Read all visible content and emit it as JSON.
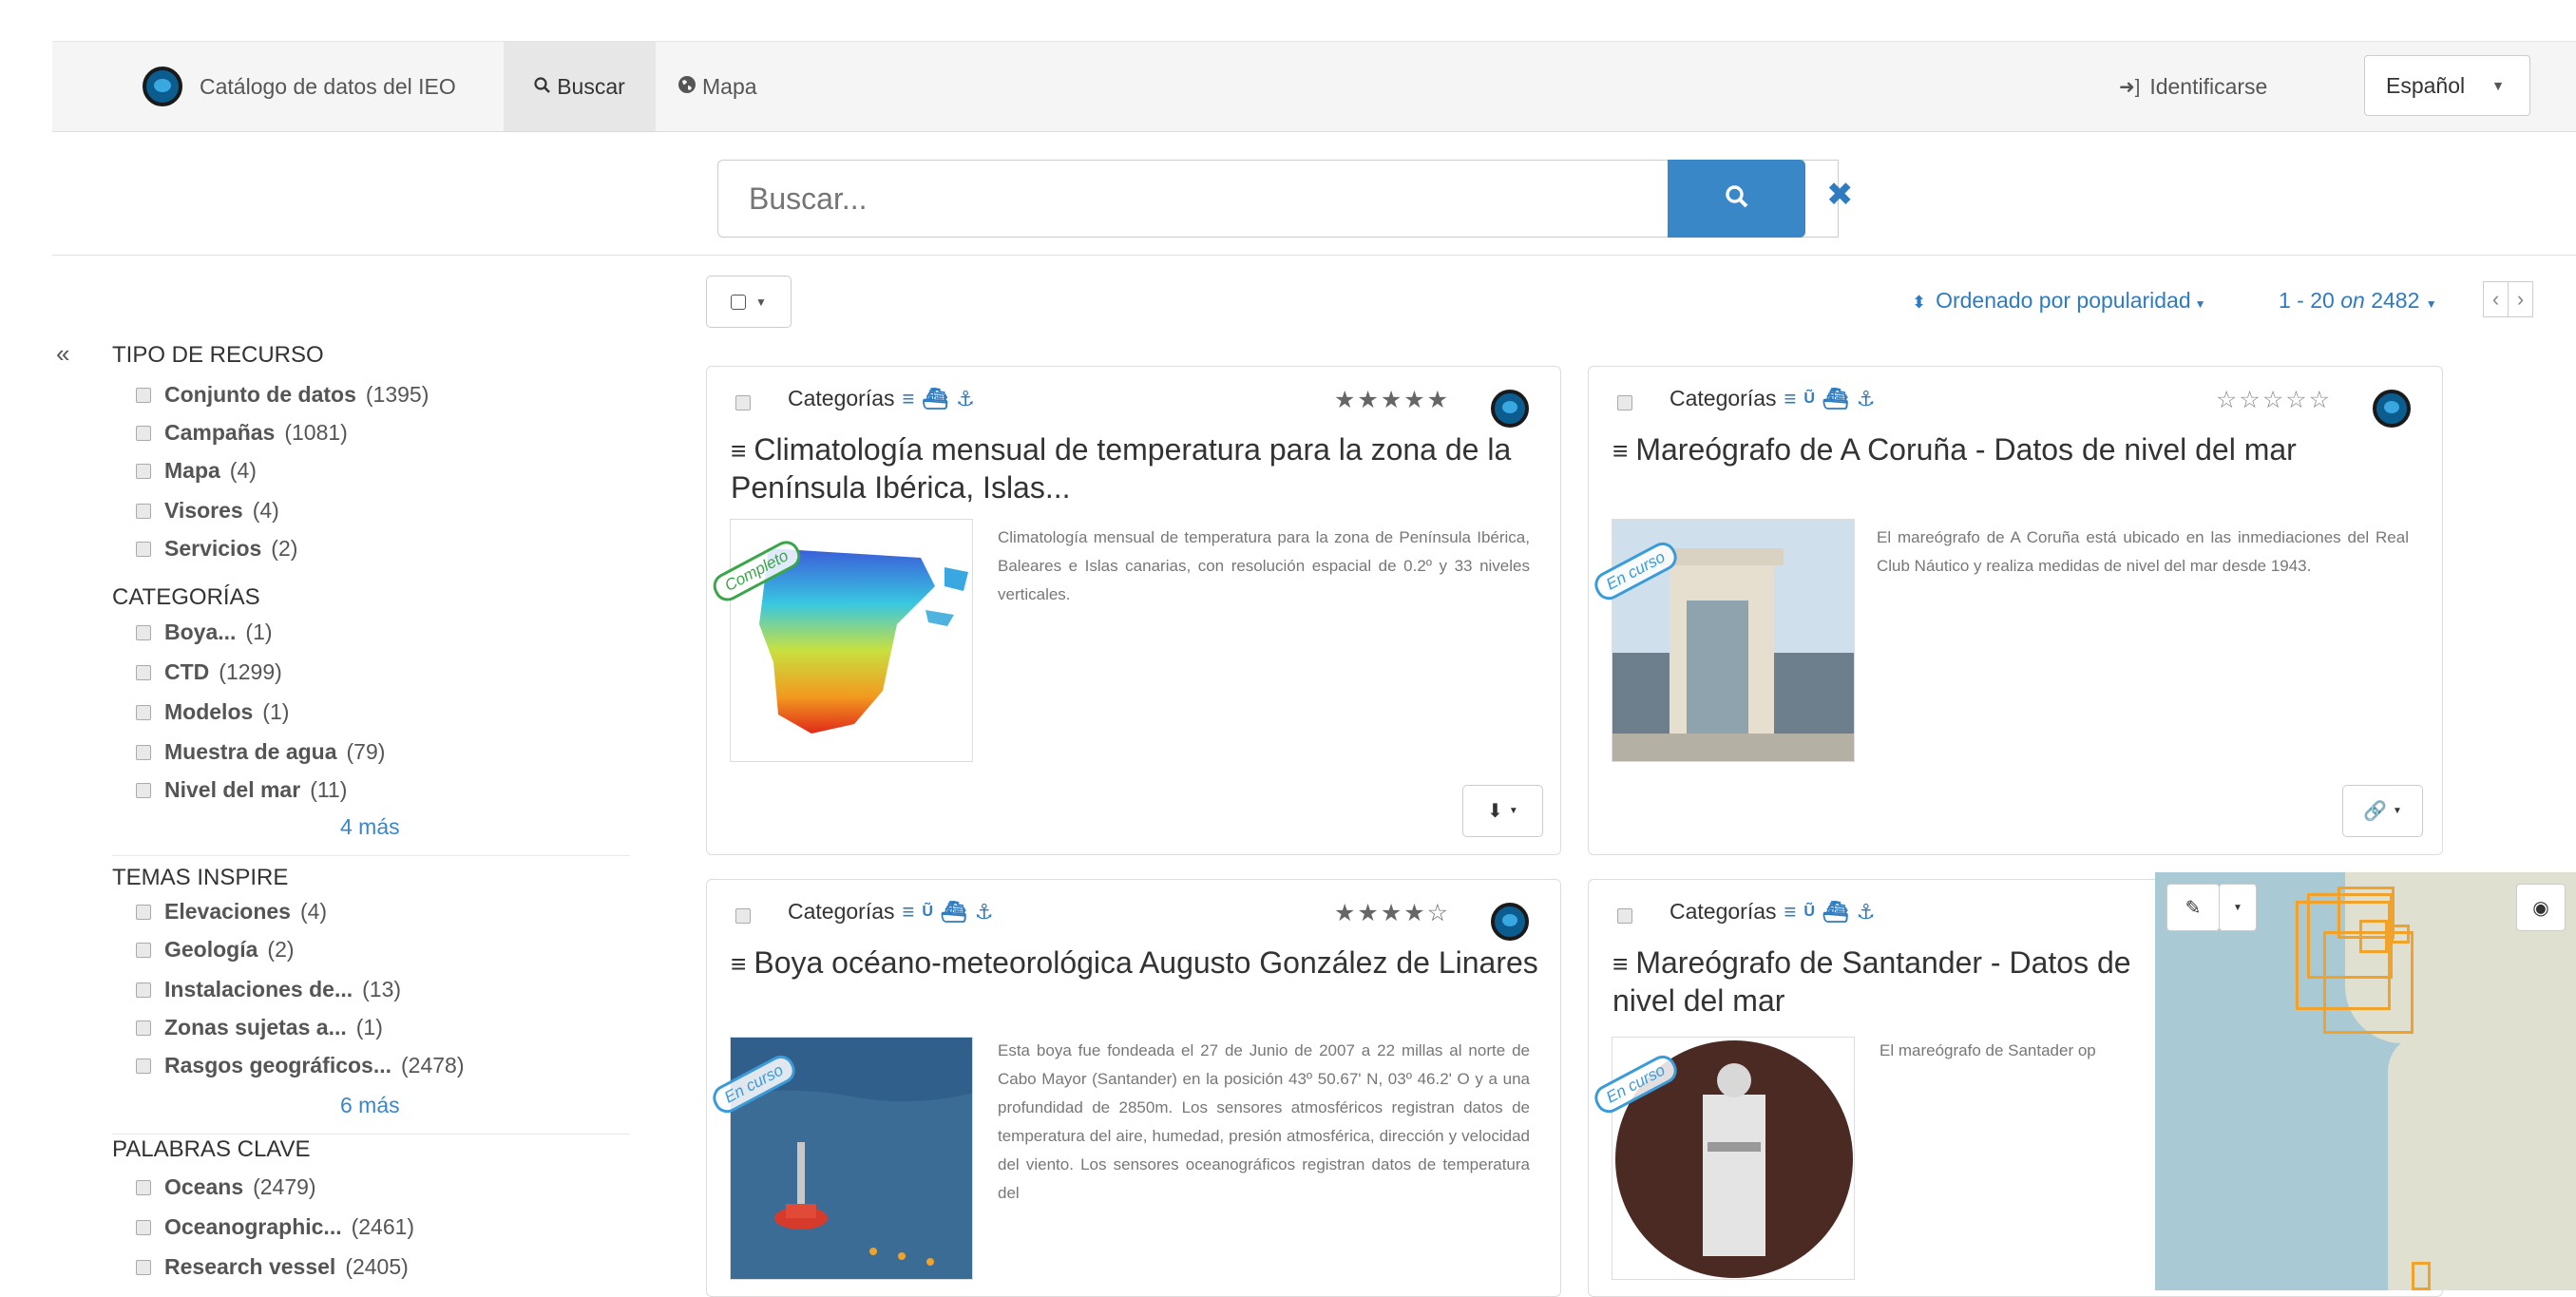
{
  "nav": {
    "brand": "Catálogo de datos del IEO",
    "search_tab": "Buscar",
    "map_tab": "Mapa",
    "login": "Identificarse",
    "language": "Español"
  },
  "search": {
    "placeholder": "Buscar..."
  },
  "toolbar": {
    "sort_label": "Ordenado por popularidad",
    "paging_range": "1 - 20",
    "paging_on": "on",
    "paging_total": "2482"
  },
  "facets": {
    "resource_type": {
      "title": "TIPO DE RECURSO",
      "items": [
        {
          "label": "Conjunto de datos",
          "count": "(1395)"
        },
        {
          "label": "Campañas",
          "count": "(1081)"
        },
        {
          "label": "Mapa",
          "count": "(4)"
        },
        {
          "label": "Visores",
          "count": "(4)"
        },
        {
          "label": "Servicios",
          "count": "(2)"
        }
      ]
    },
    "categories": {
      "title": "CATEGORÍAS",
      "items": [
        {
          "label": "Boya...",
          "count": "(1)"
        },
        {
          "label": "CTD",
          "count": "(1299)"
        },
        {
          "label": "Modelos",
          "count": "(1)"
        },
        {
          "label": "Muestra de agua",
          "count": "(79)"
        },
        {
          "label": "Nivel del mar",
          "count": "(11)"
        }
      ],
      "more": "4 más"
    },
    "inspire": {
      "title": "TEMAS INSPIRE",
      "items": [
        {
          "label": "Elevaciones",
          "count": "(4)"
        },
        {
          "label": "Geología",
          "count": "(2)"
        },
        {
          "label": "Instalaciones de...",
          "count": "(13)"
        },
        {
          "label": "Zonas sujetas a...",
          "count": "(1)"
        },
        {
          "label": "Rasgos geográficos...",
          "count": "(2478)"
        }
      ],
      "more": "6 más"
    },
    "keywords": {
      "title": "PALABRAS CLAVE",
      "items": [
        {
          "label": "Oceans",
          "count": "(2479)"
        },
        {
          "label": "Oceanographic...",
          "count": "(2461)"
        },
        {
          "label": "Research vessel",
          "count": "(2405)"
        }
      ]
    }
  },
  "cards": [
    {
      "categories": "Categorías",
      "stars": "★★★★★",
      "rating": 5,
      "title": "Climatología mensual de temperatura para la zona de la Península Ibérica, Islas...",
      "abstract": "Climatología mensual de temperatura para la zona de Península Ibérica, Baleares e Islas canarias, con resolución espacial de 0.2º y 33 niveles verticales.",
      "badge": "Completo",
      "action_icon": "download-icon"
    },
    {
      "categories": "Categorías",
      "stars": "☆☆☆☆☆",
      "rating": 0,
      "title": "Mareógrafo de A Coruña - Datos de nivel del mar",
      "abstract": "El mareógrafo de A Coruña está ubicado en las inmediaciones del Real Club Náutico y realiza medidas de nivel del mar desde 1943.",
      "badge": "En curso",
      "action_icon": "link-icon"
    },
    {
      "categories": "Categorías",
      "stars": "★★★★☆",
      "rating": 4,
      "title": "Boya océano-meteorológica Augusto González de Linares",
      "abstract": "Esta boya fue fondeada el 27 de Junio de 2007 a 22 millas al norte de Cabo Mayor (Santander) en la posición 43º 50.67' N, 03º 46.2' O y a una profundidad de 2850m. Los sensores atmosféricos registran datos de temperatura del aire, humedad, presión atmosférica, dirección y velocidad del viento. Los sensores oceanográficos registran datos de temperatura del",
      "badge": "En curso"
    },
    {
      "categories": "Categorías",
      "title": "Mareógrafo de Santander - Datos de nivel del mar",
      "abstract": "El mareógrafo de Santader op",
      "badge": "En curso"
    }
  ]
}
